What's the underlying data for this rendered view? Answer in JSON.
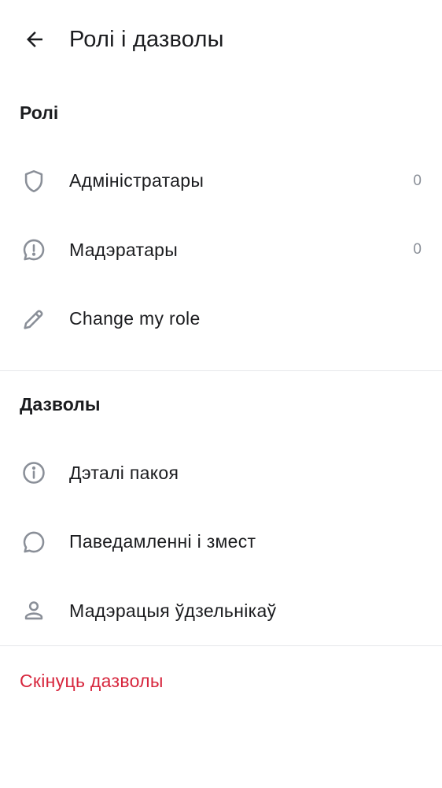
{
  "header": {
    "title": "Ролі і дазволы"
  },
  "roles_section": {
    "title": "Ролі",
    "items": [
      {
        "label": "Адміністратары",
        "count": "0",
        "icon": "shield-icon"
      },
      {
        "label": "Мадэратары",
        "count": "0",
        "icon": "alert-bubble-icon"
      },
      {
        "label": "Change my role",
        "icon": "pencil-icon"
      }
    ]
  },
  "permissions_section": {
    "title": "Дазволы",
    "items": [
      {
        "label": "Дэталі пакоя",
        "icon": "info-icon"
      },
      {
        "label": "Паведамленні і змест",
        "icon": "chat-bubble-icon"
      },
      {
        "label": "Мадэрацыя ўдзельнікаў",
        "icon": "person-icon"
      }
    ]
  },
  "reset": {
    "label": "Скінуць дазволы",
    "color": "#d7263d"
  },
  "colors": {
    "icon": "#8a8f98",
    "text": "#1b1c1f",
    "divider": "#e6e7ea"
  }
}
